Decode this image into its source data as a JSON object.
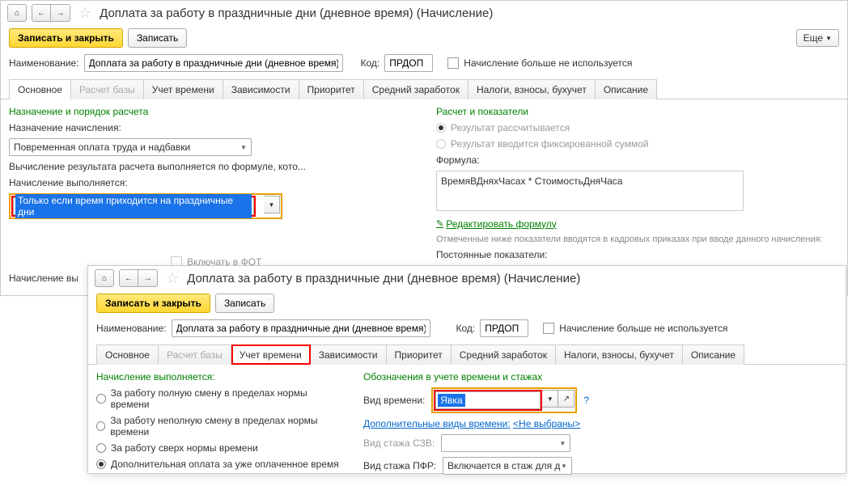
{
  "win1": {
    "title": "Доплата за работу в праздничные дни (дневное время) (Начисление)",
    "save_close": "Записать и закрыть",
    "save": "Записать",
    "more": "Еще",
    "name_lbl": "Наименование:",
    "name_val": "Доплата за работу в праздничные дни (дневное время)",
    "code_lbl": "Код:",
    "code_val": "ПРДОП",
    "not_used": "Начисление больше не используется",
    "tabs": [
      "Основное",
      "Расчет базы",
      "Учет времени",
      "Зависимости",
      "Приоритет",
      "Средний заработок",
      "Налоги, взносы, бухучет",
      "Описание"
    ],
    "left": {
      "h": "Назначение и порядок расчета",
      "purpose_lbl": "Назначение начисления:",
      "purpose_val": "Повременная оплата труда и надбавки",
      "descr": "Вычисление результата расчета выполняется по формуле, кото...",
      "when_lbl": "Начисление выполняется:",
      "when_val": "Только если время приходится на праздничные дни",
      "include_fot": "Включать в ФОТ",
      "begins": "Начисление вы"
    },
    "right": {
      "h": "Расчет и показатели",
      "r1": "Результат рассчитывается",
      "r2": "Результат вводится фиксированной суммой",
      "formula_lbl": "Формула:",
      "formula": "ВремяВДняхЧасах * СтоимостьДняЧаса",
      "edit": "Редактировать формулу",
      "note": "Отмеченные ниже показатели вводятся в кадровых приказах при вводе данного начисления:",
      "const_lbl": "Постоянные показатели:"
    }
  },
  "win2": {
    "title": "Доплата за работу в праздничные дни (дневное время) (Начисление)",
    "save_close": "Записать и закрыть",
    "save": "Записать",
    "name_lbl": "Наименование:",
    "name_val": "Доплата за работу в праздничные дни (дневное время)",
    "code_lbl": "Код:",
    "code_val": "ПРДОП",
    "not_used": "Начисление больше не используется",
    "tabs": [
      "Основное",
      "Расчет базы",
      "Учет времени",
      "Зависимости",
      "Приоритет",
      "Средний заработок",
      "Налоги, взносы, бухучет",
      "Описание"
    ],
    "left": {
      "h": "Начисление выполняется:",
      "o1": "За работу полную смену в пределах нормы времени",
      "o2": "За работу неполную смену в пределах нормы времени",
      "o3": "За работу сверх нормы времени",
      "o4": "Дополнительная оплата за уже оплаченное время"
    },
    "right": {
      "h": "Обозначения в учете времени и стажах",
      "type_lbl": "Вид времени:",
      "type_val": "Явка",
      "add_types_lbl": "Дополнительные виды времени:",
      "add_types_val": "<Не выбраны>",
      "szv_lbl": "Вид стажа СЗВ:",
      "pfr_lbl": "Вид стажа ПФР:",
      "pfr_val": "Включается в стаж для д"
    }
  }
}
